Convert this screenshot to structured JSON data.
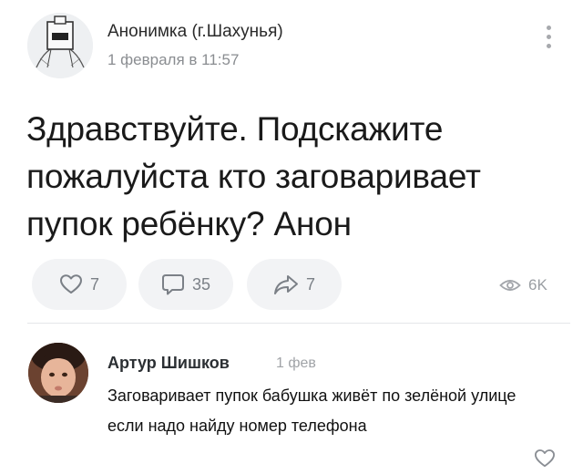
{
  "post": {
    "author": "Анонимка (г.Шахунья)",
    "date": "1 февраля в 11:57",
    "text": "Здравствуйте. Подскажите пожалуйста кто заговаривает пупок ребёнку? Анон"
  },
  "actions": {
    "likes": "7",
    "comments": "35",
    "shares": "7",
    "views": "6K"
  },
  "comment": {
    "author": "Артур Шишков",
    "date": "1 фев",
    "text": "Заговаривает пупок бабушка живёт по зелёной улице если  надо найду номер телефона"
  },
  "icons": {
    "more": "more-vertical-icon",
    "like": "heart-outline-icon",
    "comment": "comment-bubble-icon",
    "share": "share-arrow-icon",
    "views": "eye-icon"
  },
  "colors": {
    "button_bg": "#f2f3f5",
    "icon_gray": "#7b8087",
    "secondary_text": "#8a8d91",
    "divider": "#e4e6e9"
  }
}
